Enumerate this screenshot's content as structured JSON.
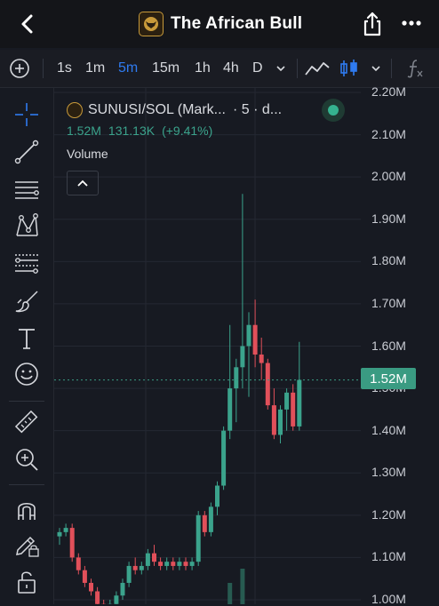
{
  "header": {
    "title": "The African Bull",
    "back_icon": "chevron-left-icon",
    "share_icon": "share-icon",
    "more_icon": "more-dots-icon"
  },
  "toolbar": {
    "add_icon": "plus-circle-icon",
    "intervals": [
      {
        "label": "1s",
        "active": false
      },
      {
        "label": "1m",
        "active": false
      },
      {
        "label": "5m",
        "active": true
      },
      {
        "label": "15m",
        "active": false
      },
      {
        "label": "1h",
        "active": false
      },
      {
        "label": "4h",
        "active": false
      },
      {
        "label": "D",
        "active": false
      }
    ],
    "accent_color": "#2f7bf0"
  },
  "sidebar": {
    "tools": [
      "crosshair-icon",
      "trend-line-icon",
      "horizontal-lines-icon",
      "pattern-icon",
      "fib-icon",
      "brush-icon",
      "text-icon",
      "emoji-icon",
      "ruler-icon",
      "zoom-in-icon",
      "magnet-icon",
      "lock-pencil-icon",
      "unlock-icon"
    ]
  },
  "legend": {
    "symbol": "SUNUSI/SOL (Mark...",
    "interval": "· 5 · d...",
    "value1": "1.52M",
    "value2": "131.13K",
    "change": "(+9.41%)",
    "volume_label": "Volume"
  },
  "colors": {
    "up": "#3ba38c",
    "down": "#e1505a",
    "background": "#171a22"
  },
  "chart_data": {
    "type": "candlestick",
    "ylim": [
      1.0,
      2.2
    ],
    "yticks": [
      "2.20M",
      "2.10M",
      "2.00M",
      "1.90M",
      "1.80M",
      "1.70M",
      "1.60M",
      "1.50M",
      "1.40M",
      "1.30M",
      "1.20M",
      "1.10M",
      "1.00M"
    ],
    "last_price": "1.52M",
    "candles": [
      {
        "o": 1.15,
        "h": 1.17,
        "l": 1.13,
        "c": 1.16
      },
      {
        "o": 1.16,
        "h": 1.18,
        "l": 1.15,
        "c": 1.17
      },
      {
        "o": 1.17,
        "h": 1.18,
        "l": 1.09,
        "c": 1.1
      },
      {
        "o": 1.1,
        "h": 1.11,
        "l": 1.06,
        "c": 1.07
      },
      {
        "o": 1.07,
        "h": 1.08,
        "l": 1.03,
        "c": 1.04
      },
      {
        "o": 1.04,
        "h": 1.05,
        "l": 1.01,
        "c": 1.02
      },
      {
        "o": 1.02,
        "h": 1.03,
        "l": 0.98,
        "c": 0.99
      },
      {
        "o": 0.99,
        "h": 1.0,
        "l": 0.97,
        "c": 0.98
      },
      {
        "o": 0.98,
        "h": 1.0,
        "l": 0.97,
        "c": 0.99
      },
      {
        "o": 0.99,
        "h": 1.02,
        "l": 0.98,
        "c": 1.01
      },
      {
        "o": 1.01,
        "h": 1.05,
        "l": 1.0,
        "c": 1.04
      },
      {
        "o": 1.04,
        "h": 1.09,
        "l": 1.03,
        "c": 1.08
      },
      {
        "o": 1.08,
        "h": 1.1,
        "l": 1.06,
        "c": 1.07
      },
      {
        "o": 1.07,
        "h": 1.09,
        "l": 1.06,
        "c": 1.08
      },
      {
        "o": 1.08,
        "h": 1.12,
        "l": 1.07,
        "c": 1.11
      },
      {
        "o": 1.11,
        "h": 1.13,
        "l": 1.08,
        "c": 1.09
      },
      {
        "o": 1.09,
        "h": 1.1,
        "l": 1.07,
        "c": 1.08
      },
      {
        "o": 1.08,
        "h": 1.1,
        "l": 1.07,
        "c": 1.09
      },
      {
        "o": 1.09,
        "h": 1.1,
        "l": 1.07,
        "c": 1.08
      },
      {
        "o": 1.08,
        "h": 1.1,
        "l": 1.07,
        "c": 1.09
      },
      {
        "o": 1.09,
        "h": 1.1,
        "l": 1.07,
        "c": 1.08
      },
      {
        "o": 1.08,
        "h": 1.1,
        "l": 1.07,
        "c": 1.09
      },
      {
        "o": 1.09,
        "h": 1.21,
        "l": 1.08,
        "c": 1.2
      },
      {
        "o": 1.2,
        "h": 1.21,
        "l": 1.15,
        "c": 1.16
      },
      {
        "o": 1.16,
        "h": 1.23,
        "l": 1.15,
        "c": 1.22
      },
      {
        "o": 1.22,
        "h": 1.28,
        "l": 1.2,
        "c": 1.27
      },
      {
        "o": 1.27,
        "h": 1.41,
        "l": 1.26,
        "c": 1.4
      },
      {
        "o": 1.4,
        "h": 1.65,
        "l": 1.38,
        "c": 1.5
      },
      {
        "o": 1.5,
        "h": 1.57,
        "l": 1.42,
        "c": 1.55
      },
      {
        "o": 1.55,
        "h": 1.96,
        "l": 1.5,
        "c": 1.6
      },
      {
        "o": 1.6,
        "h": 1.68,
        "l": 1.48,
        "c": 1.65
      },
      {
        "o": 1.65,
        "h": 1.71,
        "l": 1.55,
        "c": 1.58
      },
      {
        "o": 1.58,
        "h": 1.62,
        "l": 1.52,
        "c": 1.56
      },
      {
        "o": 1.56,
        "h": 1.57,
        "l": 1.45,
        "c": 1.46
      },
      {
        "o": 1.46,
        "h": 1.5,
        "l": 1.38,
        "c": 1.39
      },
      {
        "o": 1.39,
        "h": 1.46,
        "l": 1.37,
        "c": 1.45
      },
      {
        "o": 1.45,
        "h": 1.5,
        "l": 1.4,
        "c": 1.49
      },
      {
        "o": 1.49,
        "h": 1.51,
        "l": 1.4,
        "c": 1.41
      },
      {
        "o": 1.41,
        "h": 1.61,
        "l": 1.4,
        "c": 1.52
      }
    ],
    "volume_visible": [
      {
        "index": 27,
        "v": 0.6
      },
      {
        "index": 29,
        "v": 1.0
      }
    ]
  }
}
